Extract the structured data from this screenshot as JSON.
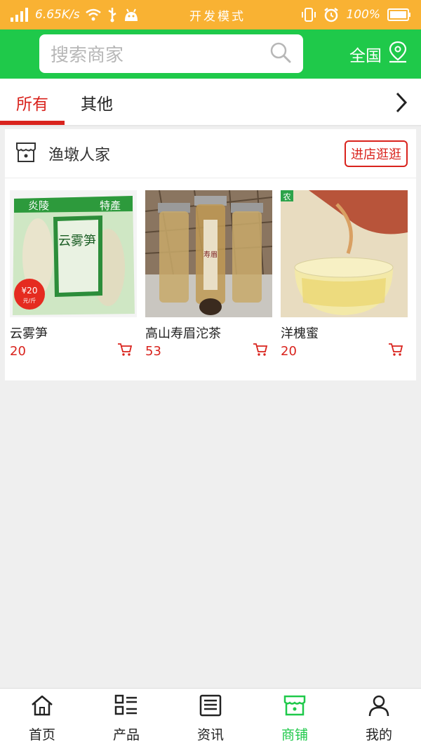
{
  "status_bar": {
    "network_speed": "6.65K/s",
    "mode_text": "开发模式",
    "battery": "100%"
  },
  "header": {
    "search_placeholder": "搜索商家",
    "region_label": "全国",
    "region_icon": "location-pin-icon"
  },
  "tabs": [
    {
      "label": "所有",
      "active": true
    },
    {
      "label": "其他",
      "active": false
    }
  ],
  "shop": {
    "name": "渔墩人家",
    "visit_label": "进店逛逛",
    "products": [
      {
        "name": "云雾笋",
        "price": "20"
      },
      {
        "name": "高山寿眉沱茶",
        "price": "53"
      },
      {
        "name": "洋槐蜜",
        "price": "20"
      }
    ],
    "product_images": [
      {
        "pack_label": "云雾笋",
        "price_sticker": "¥20",
        "price_unit": "元/斤",
        "corner_text": "炎陵",
        "corner_text_2": "特產"
      },
      {
        "jar_label": "寿眉"
      },
      {
        "corner_badge": "农"
      }
    ]
  },
  "bottom_nav": [
    {
      "label": "首页",
      "icon": "home-icon"
    },
    {
      "label": "产品",
      "icon": "list-icon"
    },
    {
      "label": "资讯",
      "icon": "news-icon"
    },
    {
      "label": "商铺",
      "icon": "store-icon",
      "active": true
    },
    {
      "label": "我的",
      "icon": "user-icon"
    }
  ],
  "colors": {
    "brand_green": "#1fc94a",
    "status_yellow": "#f9b233",
    "accent_red": "#d9231d"
  }
}
